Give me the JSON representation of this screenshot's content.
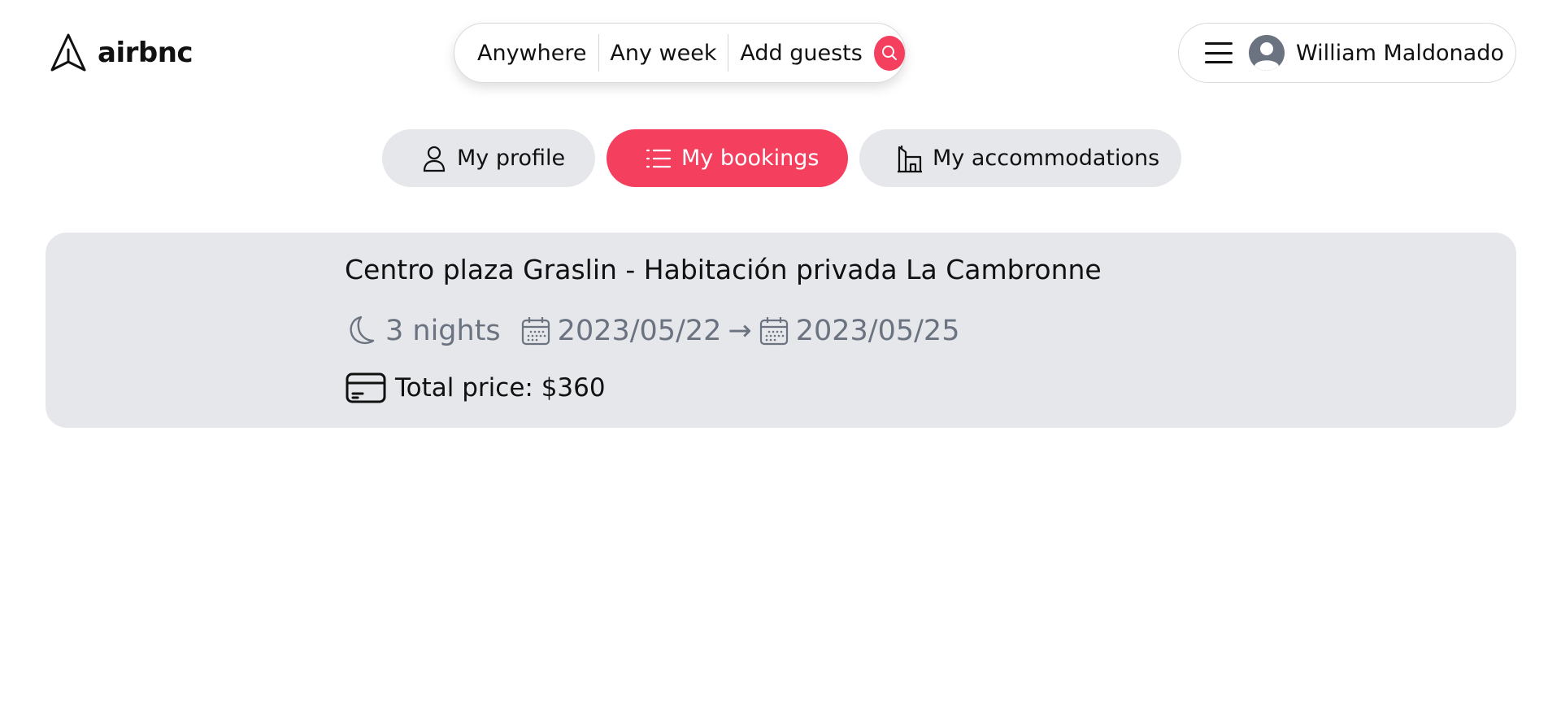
{
  "brand": {
    "name": "airbnc"
  },
  "search": {
    "location": "Anywhere",
    "dates": "Any week",
    "guests": "Add guests",
    "icon": "search-icon"
  },
  "user": {
    "name": "William Maldonado",
    "menu_icon": "hamburger-menu-icon",
    "avatar_icon": "user-avatar-icon"
  },
  "tabs": [
    {
      "label": "My profile",
      "icon": "user-icon",
      "active": false
    },
    {
      "label": "My bookings",
      "icon": "list-icon",
      "active": true
    },
    {
      "label": "My accommodations",
      "icon": "building-icon",
      "active": false
    }
  ],
  "bookings": [
    {
      "title": "Centro plaza Graslin - Habitación privada La Cambronne",
      "nights": "3 nights",
      "check_in": "2023/05/22",
      "arrow": "→",
      "check_out": "2023/05/25",
      "total_price": "Total price: $360"
    }
  ],
  "colors": {
    "accent": "#f43f5e",
    "pill_bg": "#e5e7eb",
    "muted_text": "#6b7280",
    "text": "#111111"
  }
}
